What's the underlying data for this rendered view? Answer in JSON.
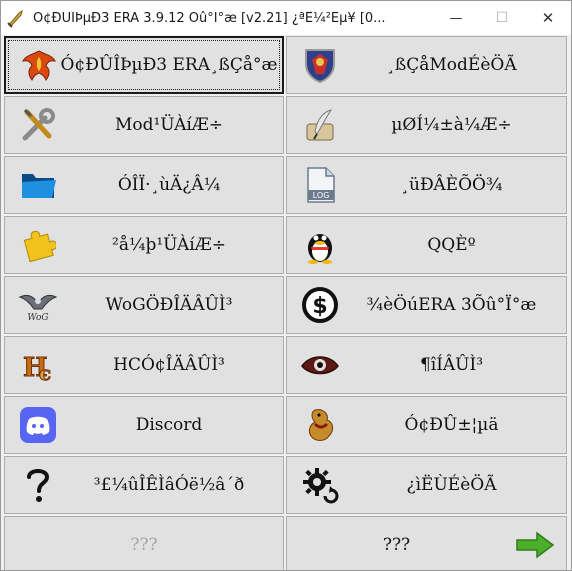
{
  "window": {
    "title": "Ó¢ÐÛÎÞµÐ3 ERA 3.9.12 Õû°Ï°æ [v2.21] ¿ªÊ¼²Ëµ¥  [0...",
    "controls": {
      "minimize": "—",
      "maximize": "☐",
      "close": "✕"
    }
  },
  "buttons": [
    {
      "label": "Ó¢ÐÛÎÞµÐ3 ERA¸ßÇå°æ",
      "icon": "phoenix-icon"
    },
    {
      "label": "¸ßÇåModÉèÖÃ",
      "icon": "shield-crest-icon"
    },
    {
      "label": "Mod¹ÜÀíÆ÷",
      "icon": "wrench-screwdriver-icon"
    },
    {
      "label": "µØÍ¼±à¼­Æ÷",
      "icon": "quill-scroll-icon"
    },
    {
      "label": "ÓÎÏ·¸ùÄ¿Â¼",
      "icon": "folder-icon"
    },
    {
      "label": "¸üÐÂÈÕÖ¾",
      "icon": "log-file-icon"
    },
    {
      "label": "²å¼þ¹ÜÀíÆ÷",
      "icon": "puzzle-icon"
    },
    {
      "label": "QQÈº",
      "icon": "qq-penguin-icon"
    },
    {
      "label": "WoGÖÐÎÄÂÛÌ³",
      "icon": "wog-eagle-icon"
    },
    {
      "label": "¾èÖúERA 3Õû°Ï°æ",
      "icon": "dollar-circle-icon"
    },
    {
      "label": "HCÓ¢ÎÄÂÛÌ³",
      "icon": "hc-logo-icon"
    },
    {
      "label": "¶îÍÂÛÌ³",
      "icon": "eye-icon"
    },
    {
      "label": "Discord",
      "icon": "discord-icon"
    },
    {
      "label": "Ó¢ÐÛ±¦µä",
      "icon": "griffin-icon"
    },
    {
      "label": "³£¼ûÎÊÌâÓë½â´ð",
      "icon": "question-mark-icon"
    },
    {
      "label": "¿ìËÙÉèÖÃ",
      "icon": "gear-refresh-icon"
    },
    {
      "label": "???",
      "icon": ""
    },
    {
      "label": "???",
      "icon": "green-arrow-icon"
    }
  ]
}
